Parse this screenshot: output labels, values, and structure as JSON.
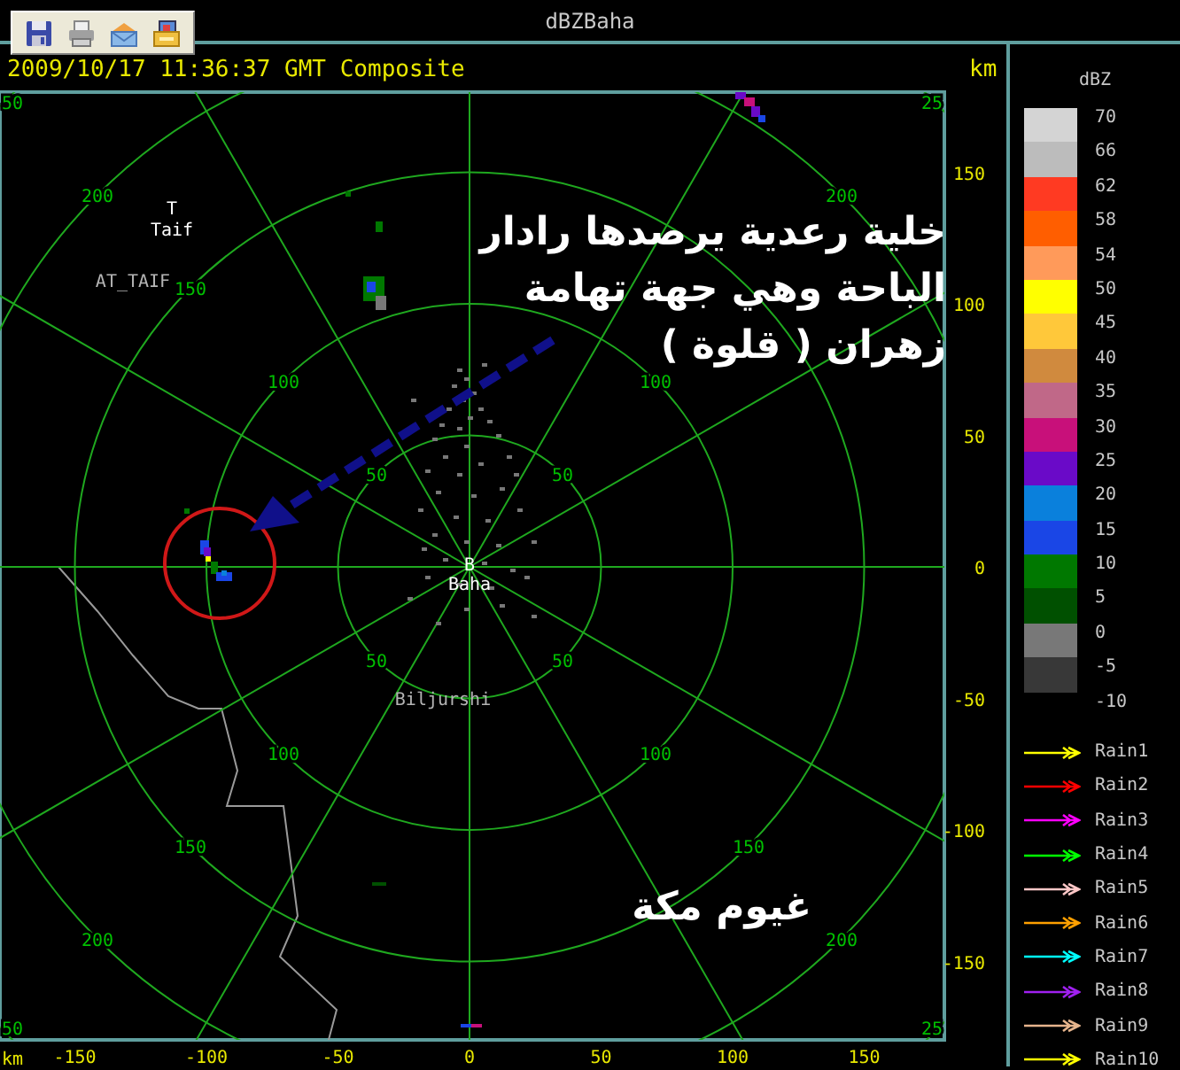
{
  "window": {
    "title": "dBZBaha"
  },
  "toolbar": {
    "buttons": [
      {
        "kind": "save"
      },
      {
        "kind": "print"
      },
      {
        "kind": "mail"
      },
      {
        "kind": "folder"
      }
    ]
  },
  "header": {
    "timestamp": "2009/10/17 11:36:37 GMT Composite",
    "unit": "km"
  },
  "plot": {
    "rings": [
      {
        "labels": [
          "50",
          "50",
          "50",
          "50"
        ]
      },
      {
        "labels": [
          "100",
          "100",
          "100",
          "100"
        ]
      },
      {
        "labels": [
          "150",
          "150",
          "150"
        ]
      },
      {
        "labels": [
          "200",
          "200",
          "200",
          "200"
        ]
      },
      {
        "labels": [
          "50",
          "25",
          "50",
          "25"
        ]
      }
    ],
    "y_axis_labels": [
      "150",
      "100",
      "50",
      "0",
      "-50",
      "-100",
      "-150"
    ],
    "x_axis_labels": [
      "-150",
      "-100",
      "-50",
      "0",
      "50",
      "100",
      "150"
    ],
    "x_axis_unit": "km",
    "places": [
      {
        "marker": "T",
        "name": "Taif"
      },
      {
        "name": "AT_TAIF"
      },
      {
        "marker": "B",
        "name": "Baha"
      },
      {
        "name": "Biljurshi"
      }
    ],
    "annotations": [
      {
        "lines": [
          "خلية رعدية يرصدها رادار",
          "الباحة وهي جهة تهامة",
          "زهران ( قلوة )"
        ]
      },
      {
        "lines": [
          "غيوم مكة"
        ]
      }
    ]
  },
  "color_scale": {
    "unit": "dBZ",
    "bins": [
      {
        "color": "#d4d4d4"
      },
      {
        "color": "#bcbcbc"
      },
      {
        "color": "#ff3a22"
      },
      {
        "color": "#ff5e00"
      },
      {
        "color": "#ff9a5a"
      },
      {
        "color": "#ffff00"
      },
      {
        "color": "#ffc83a"
      },
      {
        "color": "#d08a3e"
      },
      {
        "color": "#c06888"
      },
      {
        "color": "#c8107a"
      },
      {
        "color": "#6a0ac8"
      },
      {
        "color": "#0a80dc"
      },
      {
        "color": "#1a46e6"
      },
      {
        "color": "#007800"
      },
      {
        "color": "#005000"
      },
      {
        "color": "#787878"
      },
      {
        "color": "#383838"
      }
    ],
    "labels": [
      "70",
      "66",
      "62",
      "58",
      "54",
      "50",
      "45",
      "40",
      "35",
      "30",
      "25",
      "20",
      "15",
      "10",
      "5",
      "0",
      "-5",
      "-10"
    ]
  },
  "storm_tracks": [
    {
      "label": "Rain1",
      "color": "#ffff00"
    },
    {
      "label": "Rain2",
      "color": "#ff0000"
    },
    {
      "label": "Rain3",
      "color": "#ff00ff"
    },
    {
      "label": "Rain4",
      "color": "#00ff00"
    },
    {
      "label": "Rain5",
      "color": "#ffc8c8"
    },
    {
      "label": "Rain6",
      "color": "#ffa000"
    },
    {
      "label": "Rain7",
      "color": "#00ffff"
    },
    {
      "label": "Rain8",
      "color": "#a020f0"
    },
    {
      "label": "Rain9",
      "color": "#e6b48c"
    },
    {
      "label": "Rain10",
      "color": "#ffff00"
    }
  ]
}
